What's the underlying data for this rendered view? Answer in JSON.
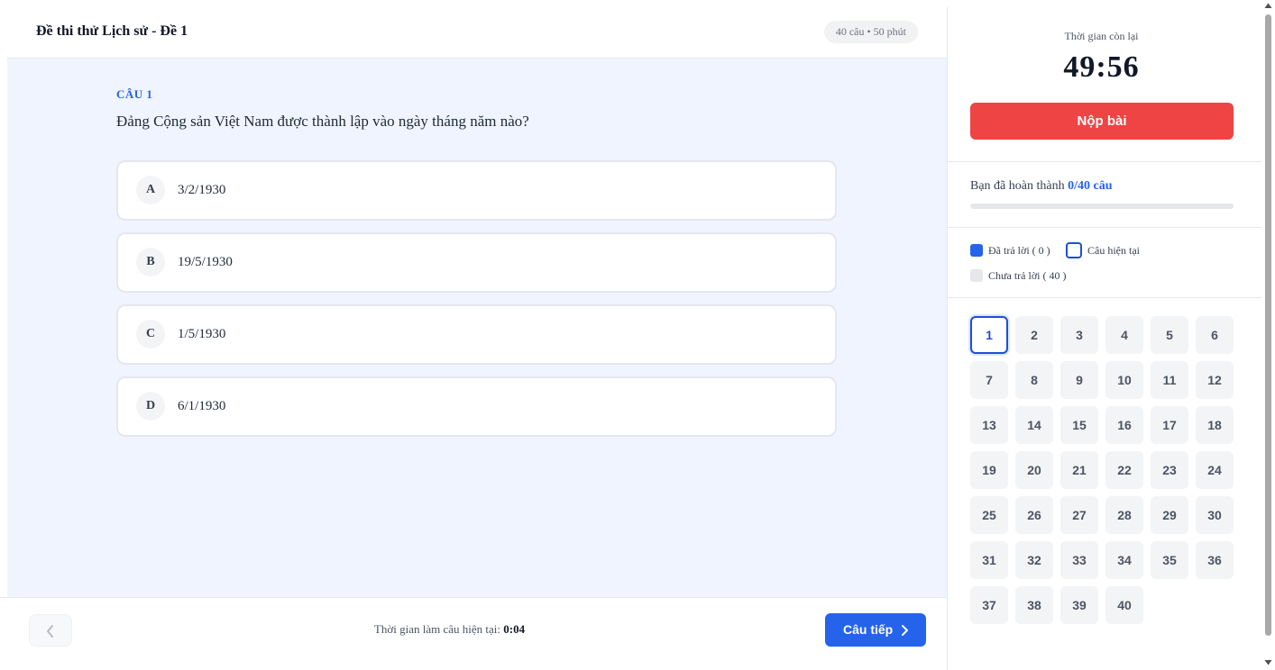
{
  "header": {
    "title": "Đề thi thử Lịch sử - Đề 1",
    "meta": "40 câu • 50 phút"
  },
  "question": {
    "label": "CÂU 1",
    "text": "Đảng Cộng sản Việt Nam được thành lập vào ngày tháng năm nào?",
    "options": [
      {
        "letter": "A",
        "text": "3/2/1930"
      },
      {
        "letter": "B",
        "text": "19/5/1930"
      },
      {
        "letter": "C",
        "text": "1/5/1930"
      },
      {
        "letter": "D",
        "text": "6/1/1930"
      }
    ]
  },
  "footer": {
    "prev_icon": "chevron-left-icon",
    "current_time_label": "Thời gian làm câu hiện tại:",
    "current_time_value": "0:04",
    "next_label": "Câu tiếp",
    "next_icon": "chevron-right-icon"
  },
  "sidebar": {
    "time_left_label": "Thời gian còn lại",
    "time_left": "49:56",
    "submit_label": "Nộp bài",
    "progress_label": "Bạn đã hoàn thành",
    "progress_count": "0/40 câu",
    "progress_fraction": 0,
    "legend": {
      "answered": "Đã trả lời ( 0 )",
      "current": "Câu hiện tại",
      "unanswered": "Chưa trả lời ( 40 )"
    },
    "current_question": 1,
    "questions": [
      "1",
      "2",
      "3",
      "4",
      "5",
      "6",
      "7",
      "8",
      "9",
      "10",
      "11",
      "12",
      "13",
      "14",
      "15",
      "16",
      "17",
      "18",
      "19",
      "20",
      "21",
      "22",
      "23",
      "24",
      "25",
      "26",
      "27",
      "28",
      "29",
      "30",
      "31",
      "32",
      "33",
      "34",
      "35",
      "36",
      "37",
      "38",
      "39",
      "40"
    ]
  },
  "colors": {
    "accent": "#2563eb",
    "submit": "#ef4444",
    "content_bg": "#eff4fe"
  }
}
